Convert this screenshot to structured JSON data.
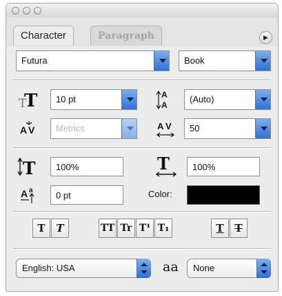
{
  "window": {
    "traffic_lights": [
      "close",
      "minimize",
      "zoom"
    ],
    "tabs": [
      {
        "label": "Character",
        "active": true
      },
      {
        "label": "Paragraph",
        "active": false
      }
    ],
    "menu_button_glyph": "▶"
  },
  "font": {
    "family": "Futura",
    "style": "Book"
  },
  "size": {
    "font_size": "10 pt",
    "leading": "(Auto)",
    "kerning": "Metrics",
    "tracking": "50"
  },
  "scale": {
    "vertical_scale": "100%",
    "horizontal_scale": "100%",
    "baseline_shift": "0 pt",
    "color_label": "Color:",
    "color_value": "#000000"
  },
  "style_buttons": [
    {
      "name": "faux-bold-button",
      "glyph": "T"
    },
    {
      "name": "faux-italic-button",
      "glyph": "T"
    },
    {
      "name": "all-caps-button",
      "glyph": "TT"
    },
    {
      "name": "small-caps-button",
      "glyph": "Tr"
    },
    {
      "name": "superscript-button",
      "glyph": "T¹"
    },
    {
      "name": "subscript-button",
      "glyph": "T₁"
    },
    {
      "name": "underline-button",
      "glyph": "T"
    },
    {
      "name": "strikethrough-button",
      "glyph": "T"
    }
  ],
  "bottom": {
    "language": "English: USA",
    "antialias_glyph": "aa",
    "antialias": "None"
  }
}
